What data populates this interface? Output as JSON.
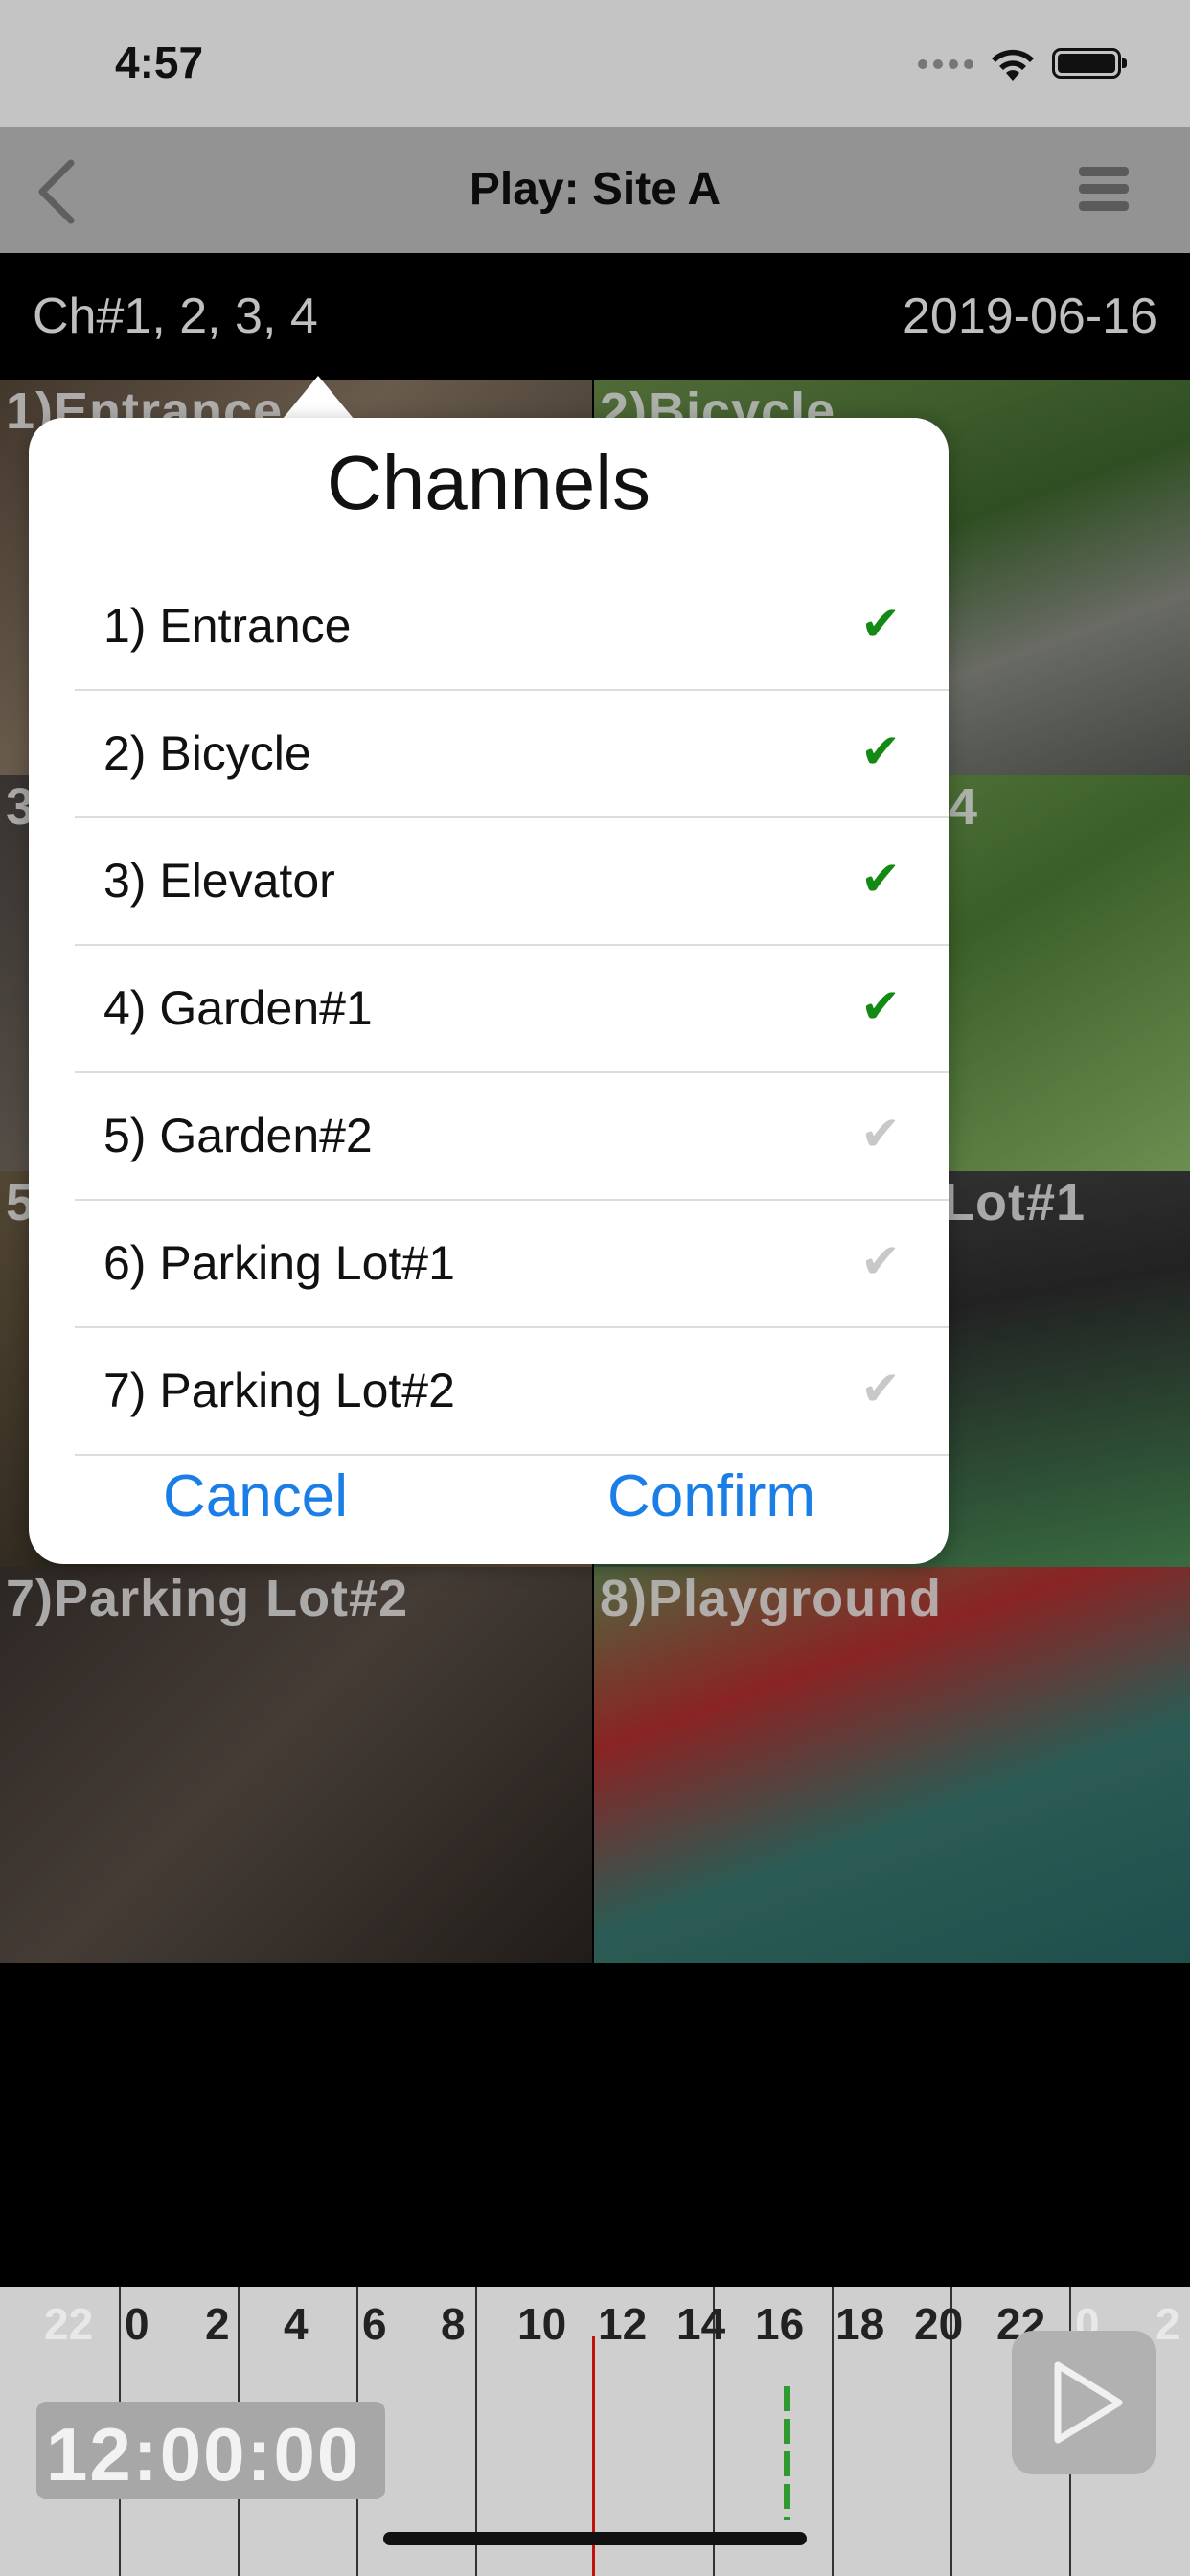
{
  "status": {
    "time": "4:57"
  },
  "nav": {
    "title": "Play: Site A"
  },
  "info": {
    "channels": "Ch#1, 2, 3, 4",
    "date": "2019-06-16"
  },
  "grid": {
    "cells": [
      {
        "label": "1)Entrance"
      },
      {
        "label": "2)Bicycle"
      },
      {
        "label": "3"
      },
      {
        "label": "4"
      },
      {
        "label": "5"
      },
      {
        "label": "Lot#1"
      },
      {
        "label": "7)Parking Lot#2"
      },
      {
        "label": "8)Playground"
      }
    ]
  },
  "popup": {
    "title": "Channels",
    "items": [
      {
        "label": "1) Entrance",
        "check": "✔",
        "selected": true
      },
      {
        "label": "2) Bicycle",
        "check": "✔",
        "selected": true
      },
      {
        "label": "3) Elevator",
        "check": "✔",
        "selected": true
      },
      {
        "label": "4) Garden#1",
        "check": "✔",
        "selected": true
      },
      {
        "label": "5) Garden#2",
        "check": "✔",
        "selected": false
      },
      {
        "label": "6) Parking Lot#1",
        "check": "✔",
        "selected": false
      },
      {
        "label": "7) Parking Lot#2",
        "check": "✔",
        "selected": false
      }
    ],
    "cancel": "Cancel",
    "confirm": "Confirm"
  },
  "timeline": {
    "ticks": [
      "22",
      "0",
      "2",
      "4",
      "6",
      "8",
      "10",
      "12",
      "14",
      "16",
      "18",
      "20",
      "22",
      "0",
      "2"
    ],
    "current_time": "12:00:00"
  },
  "colors": {
    "accent": "#1a7ee6",
    "selected_check": "#138a13",
    "unselected_check": "#c8c8c8"
  }
}
